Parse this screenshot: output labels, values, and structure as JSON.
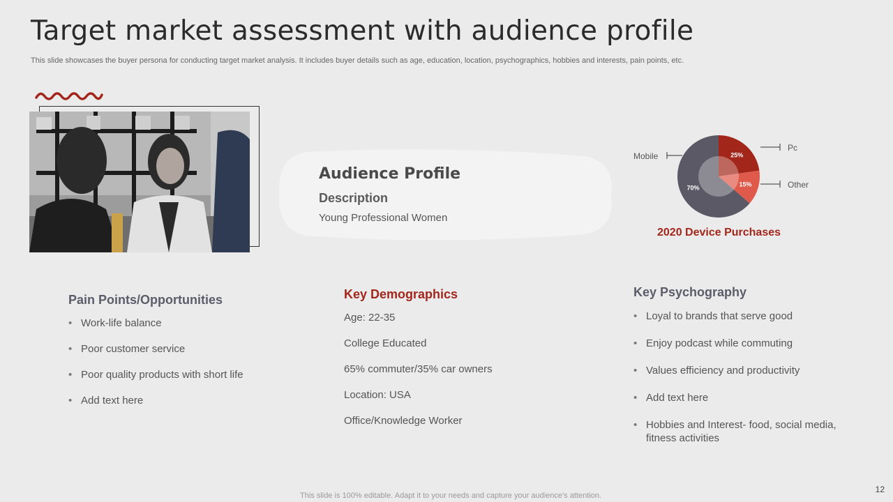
{
  "slide": {
    "title": "Target market assessment with audience profile",
    "subtitle": "This slide showcases the buyer persona for conducting target market analysis. It includes buyer details such as age, education, location, psychographics, hobbies and interests, pain points, etc.",
    "footer": "This slide is 100% editable. Adapt it to your needs and capture your audience's attention.",
    "page_number": "12"
  },
  "profile": {
    "title": "Audience Profile",
    "description_label": "Description",
    "description": "Young Professional Women"
  },
  "chart_data": {
    "type": "pie",
    "title": "2020 Device Purchases",
    "categories": [
      "Pc",
      "Other",
      "Mobile"
    ],
    "values": [
      25,
      15,
      70
    ],
    "value_labels": [
      "25%",
      "15%",
      "70%"
    ],
    "colors": [
      "#a3261b",
      "#e05a4b",
      "#5b5966"
    ]
  },
  "pain_points": {
    "title": "Pain Points/Opportunities",
    "items": [
      "Work-life balance",
      "Poor customer service",
      "Poor quality products with short life",
      "Add text here"
    ]
  },
  "demographics": {
    "title": "Key Demographics",
    "items": [
      "Age: 22-35",
      "College Educated",
      "65% commuter/35% car owners",
      "Location: USA",
      "Office/Knowledge Worker"
    ]
  },
  "psychography": {
    "title": "Key Psychography",
    "items": [
      "Loyal to brands that serve good",
      "Enjoy podcast while commuting",
      "Values efficiency and productivity",
      "Add text here",
      "Hobbies and Interest- food, social media, fitness activities"
    ]
  },
  "colors": {
    "accent_red": "#a3261b",
    "dark_gray": "#5c5c6a",
    "background": "#ebebeb"
  }
}
